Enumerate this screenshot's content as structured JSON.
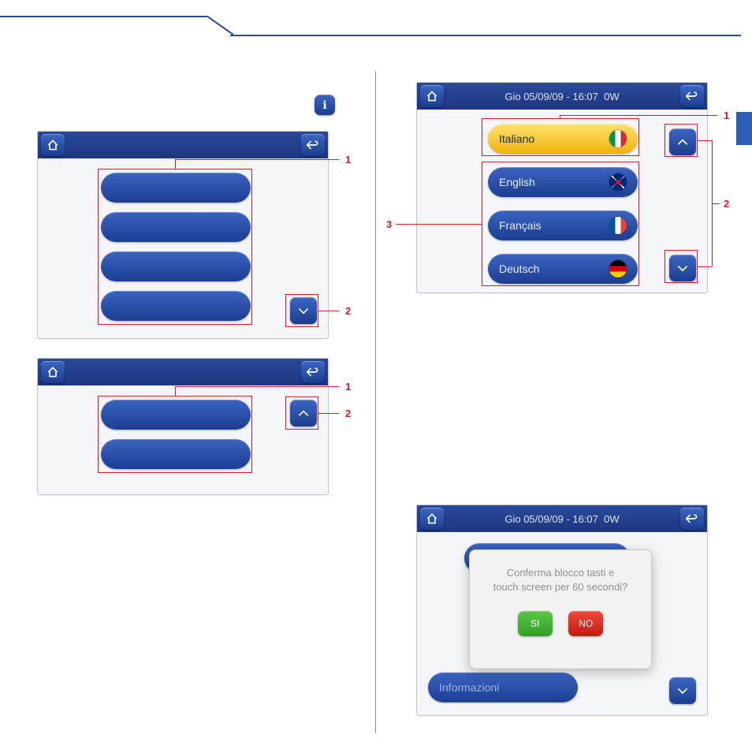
{
  "header": {
    "datetime": "Gio 05/09/09 - 16:07",
    "power": "0W"
  },
  "languages": {
    "items": [
      {
        "label": "Italiano",
        "flag": "it",
        "selected": true
      },
      {
        "label": "English",
        "flag": "uk",
        "selected": false
      },
      {
        "label": "Français",
        "flag": "fr",
        "selected": false
      },
      {
        "label": "Deutsch",
        "flag": "de",
        "selected": false
      }
    ]
  },
  "dialog": {
    "line1": "Conferma blocco tasti e",
    "line2": "touch screen per 60 secondi?",
    "yes": "SI",
    "no": "NO",
    "behind_label": "Informazioni"
  },
  "callouts": {
    "one": "1",
    "two": "2",
    "three": "3"
  }
}
